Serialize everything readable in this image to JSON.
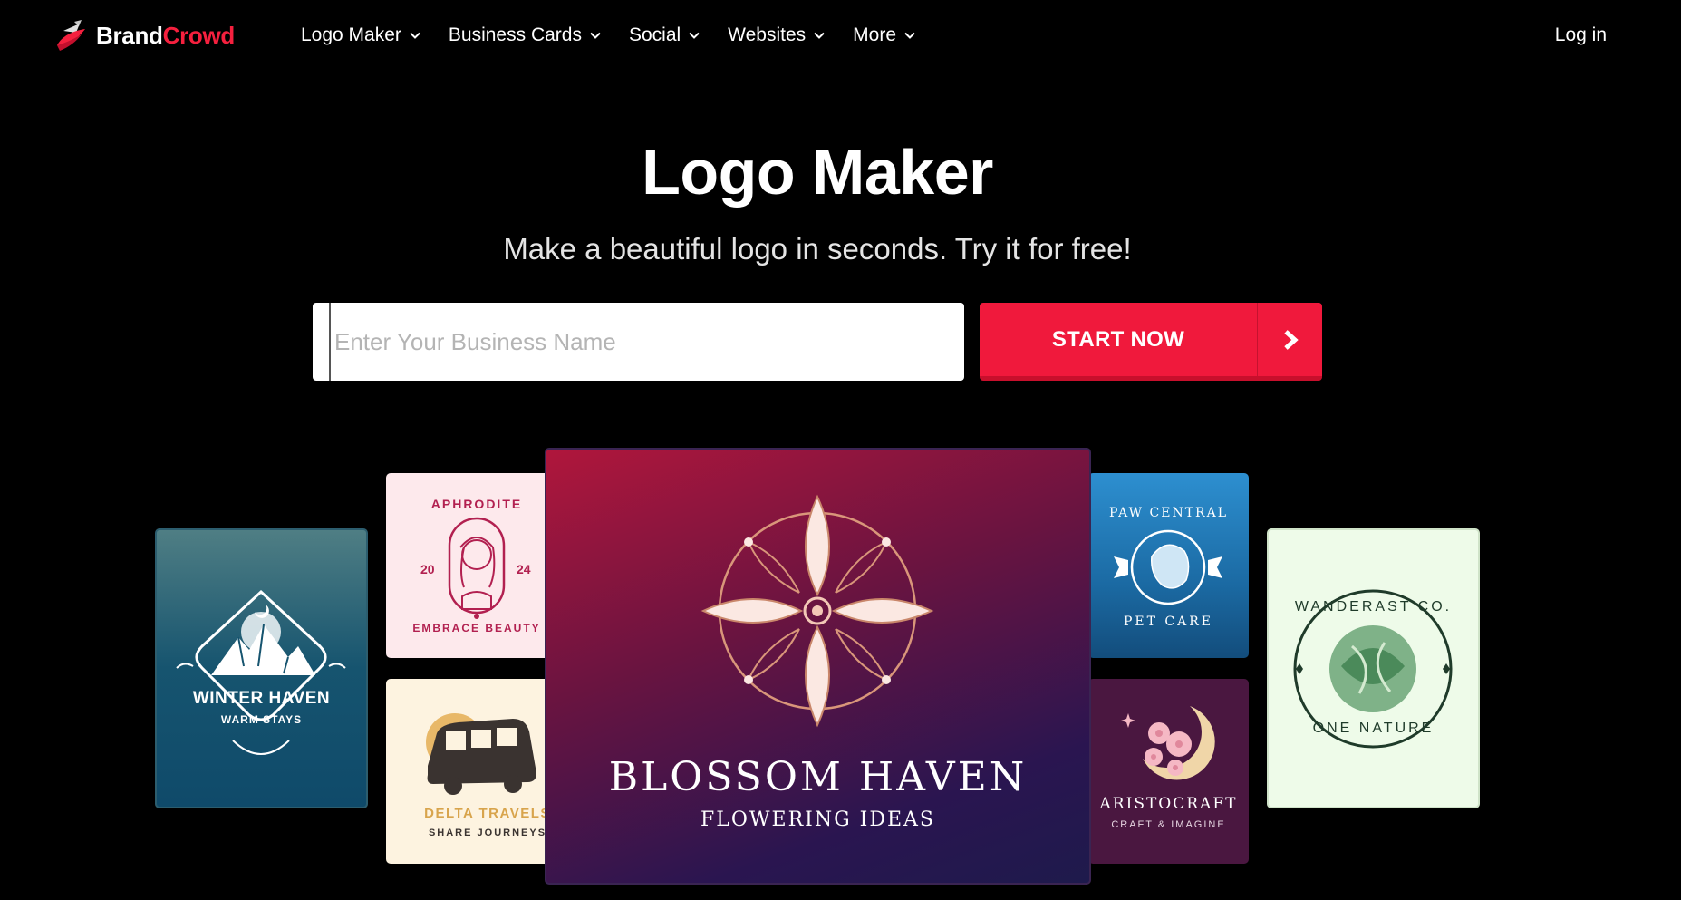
{
  "brand": {
    "part1": "Brand",
    "part2": "Crowd",
    "accent": "#f5203e"
  },
  "nav": {
    "items": [
      {
        "label": "Logo Maker"
      },
      {
        "label": "Business Cards"
      },
      {
        "label": "Social"
      },
      {
        "label": "Websites"
      },
      {
        "label": "More"
      }
    ],
    "login": "Log in"
  },
  "hero": {
    "title": "Logo Maker",
    "subtitle": "Make a beautiful logo in seconds. Try it for free!",
    "search_placeholder": "Enter Your Business Name",
    "search_value": "",
    "start_label": "START NOW"
  },
  "cards": {
    "winter": {
      "name": "WINTER HAVEN",
      "tagline": "WARM STAYS"
    },
    "aphrodite": {
      "top": "APHRODITE",
      "bottom": "EMBRACE BEAUTY",
      "left": "20",
      "right": "24"
    },
    "delta": {
      "name": "DELTA TRAVELS",
      "tagline": "SHARE JOURNEYS"
    },
    "blossom": {
      "name": "BLOSSOM HAVEN",
      "tagline": "FLOWERING IDEAS"
    },
    "paw": {
      "top": "PAW CENTRAL",
      "bottom": "PET CARE"
    },
    "aristo": {
      "name": "ARISTOCRAFT",
      "tagline": "CRAFT & IMAGINE"
    },
    "wander": {
      "top": "WANDERAST CO.",
      "bottom": "ONE NATURE"
    }
  },
  "colors": {
    "start_button": "#f0193c",
    "page_bg": "#000000"
  }
}
